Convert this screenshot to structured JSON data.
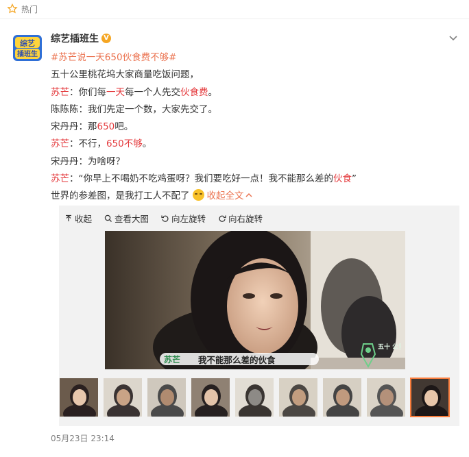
{
  "hot_label": "热门",
  "author": {
    "name": "综艺插班生",
    "avatar_text": "综艺 插班生"
  },
  "post": {
    "topic": "#苏芒说一天650伙食费不够#",
    "lines": [
      {
        "id": "l1",
        "parts": [
          {
            "t": "五十公里桃花坞大家商量吃饭问题，",
            "c": "normal"
          }
        ]
      },
      {
        "id": "l2",
        "parts": [
          {
            "t": "苏芒",
            "c": "red"
          },
          {
            "t": "：你们每",
            "c": "normal"
          },
          {
            "t": "一天",
            "c": "red"
          },
          {
            "t": "每一个人先交",
            "c": "normal"
          },
          {
            "t": "伙食费",
            "c": "red"
          },
          {
            "t": "。",
            "c": "normal"
          }
        ]
      },
      {
        "id": "l3",
        "parts": [
          {
            "t": "陈陈陈：我们先定一个数，大家先交了。",
            "c": "normal"
          }
        ]
      },
      {
        "id": "l4",
        "parts": [
          {
            "t": "宋丹丹：那",
            "c": "normal"
          },
          {
            "t": "650",
            "c": "red"
          },
          {
            "t": "吧。",
            "c": "normal"
          }
        ]
      },
      {
        "id": "l5",
        "parts": [
          {
            "t": "苏芒",
            "c": "red"
          },
          {
            "t": "：不行，",
            "c": "normal"
          },
          {
            "t": "650不够",
            "c": "red"
          },
          {
            "t": "。",
            "c": "normal"
          }
        ]
      },
      {
        "id": "l6",
        "parts": [
          {
            "t": "宋丹丹：为啥呀？",
            "c": "normal"
          }
        ]
      },
      {
        "id": "l7",
        "parts": [
          {
            "t": "苏芒",
            "c": "red"
          },
          {
            "t": "：“你早上不喝奶不吃鸡蛋呀？我们要吃好一点！我不能那么差的",
            "c": "normal"
          },
          {
            "t": "伙食",
            "c": "red"
          },
          {
            "t": "”",
            "c": "normal"
          }
        ]
      }
    ],
    "last_line": "世界的参差图，是我打工人不配了",
    "expand_label": "收起全文",
    "timestamp": "05月23日 23:14"
  },
  "media": {
    "toolbar": [
      {
        "id": "collapse",
        "label": "收起"
      },
      {
        "id": "view_large",
        "label": "查看大图"
      },
      {
        "id": "rotate_left",
        "label": "向左旋转"
      },
      {
        "id": "rotate_right",
        "label": "向右旋转"
      }
    ],
    "subtitle_name": "苏芒",
    "subtitle_text": "我不能那么差的伙食",
    "watermark": "五十 公里 桃花坞",
    "thumbnail_count": 9,
    "active_thumbnail": 9
  },
  "colors": {
    "accent": "#eb7350",
    "highlight_red": "#e4393c",
    "badge": "#f5a623",
    "active_thumb_border": "#fa7d3c"
  }
}
